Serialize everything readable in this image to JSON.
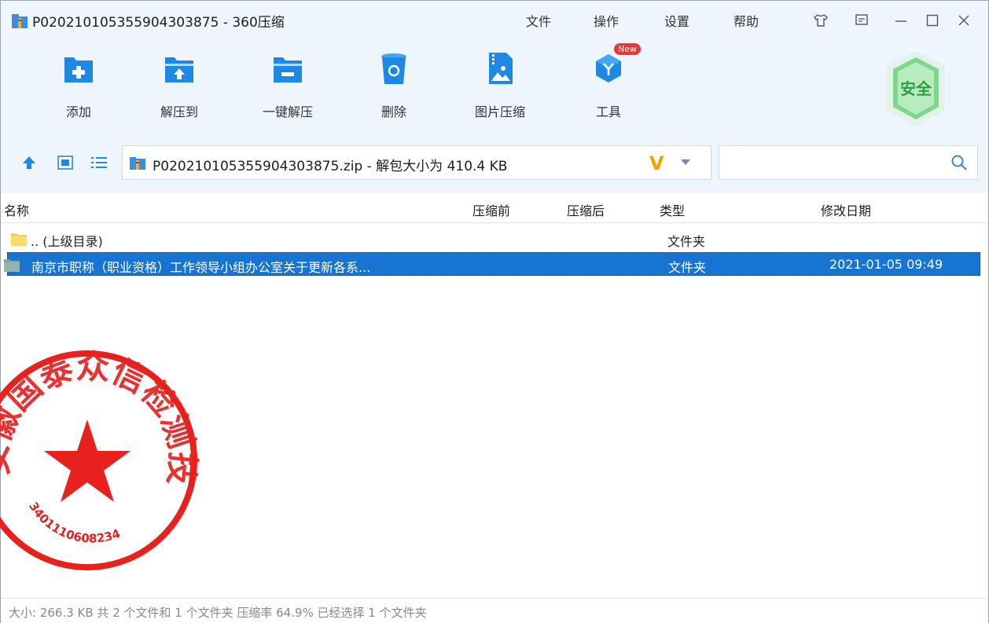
{
  "window": {
    "title": "P020210105355904303875 - 360压缩"
  },
  "menu": {
    "items": [
      "文件",
      "操作",
      "设置",
      "帮助"
    ]
  },
  "toolbar": {
    "items": [
      {
        "label": "添加",
        "icon": "add-folder-icon"
      },
      {
        "label": "解压到",
        "icon": "extract-to-icon"
      },
      {
        "label": "一键解压",
        "icon": "one-click-extract-icon"
      },
      {
        "label": "删除",
        "icon": "trash-icon"
      },
      {
        "label": "图片压缩",
        "icon": "image-compress-icon"
      },
      {
        "label": "工具",
        "icon": "tools-icon"
      }
    ],
    "new_badge": "New",
    "safe_badge": "安全"
  },
  "address": {
    "text": "P020210105355904303875.zip - 解包大小为 410.4 KB",
    "v_label": "V"
  },
  "search": {
    "placeholder": ""
  },
  "columns": {
    "name": "名称",
    "before": "压缩前",
    "after": "压缩后",
    "type": "类型",
    "modified": "修改日期"
  },
  "rows": [
    {
      "name": ".. (上级目录)",
      "type": "文件夹",
      "modified": ""
    },
    {
      "name": "南京市职称（职业资格）工作领导小组办公室关于更新各系...",
      "type": "文件夹",
      "modified": "2021-01-05 09:49"
    }
  ],
  "status": {
    "text": "大小: 266.3 KB 共 2 个文件和 1 个文件夹 压缩率 64.9% 已经选择 1 个文件夹"
  },
  "seal": {
    "company_text": "安徽国泰众信检测技术有限公司",
    "code": "3401110608234"
  },
  "colors": {
    "accent": "#1874d2",
    "toolbar_bg": "#eef5fd",
    "icon_blue": "#1e88e5",
    "seal_red": "#e8201e"
  }
}
